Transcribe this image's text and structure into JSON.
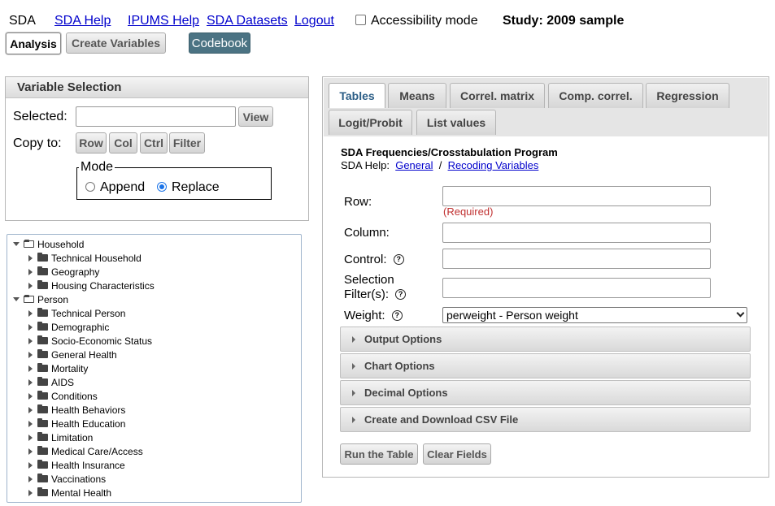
{
  "topnav": {
    "brand": "SDA",
    "links": [
      "SDA Help",
      "IPUMS Help",
      "SDA Datasets",
      "Logout"
    ],
    "accessibility_label": "Accessibility mode",
    "accessibility_checked": false,
    "study": "Study: 2009 sample"
  },
  "mode_buttons": {
    "analysis": "Analysis",
    "create_variables": "Create Variables",
    "codebook": "Codebook"
  },
  "variable_selection": {
    "title": "Variable Selection",
    "selected_label": "Selected:",
    "selected_value": "",
    "view_button": "View",
    "copy_to_label": "Copy to:",
    "copy_buttons": [
      "Row",
      "Col",
      "Ctrl",
      "Filter"
    ],
    "mode_legend": "Mode",
    "mode_options": [
      "Append",
      "Replace"
    ],
    "mode_selected": "Replace"
  },
  "tree": {
    "items": [
      {
        "label": "Household",
        "level": 0,
        "expanded": true
      },
      {
        "label": "Technical Household",
        "level": 1
      },
      {
        "label": "Geography",
        "level": 1
      },
      {
        "label": "Housing Characteristics",
        "level": 1
      },
      {
        "label": "Person",
        "level": 0,
        "expanded": true
      },
      {
        "label": "Technical Person",
        "level": 1
      },
      {
        "label": "Demographic",
        "level": 1
      },
      {
        "label": "Socio-Economic Status",
        "level": 1
      },
      {
        "label": "General Health",
        "level": 1
      },
      {
        "label": "Mortality",
        "level": 1
      },
      {
        "label": "AIDS",
        "level": 1
      },
      {
        "label": "Conditions",
        "level": 1
      },
      {
        "label": "Health Behaviors",
        "level": 1
      },
      {
        "label": "Health Education",
        "level": 1
      },
      {
        "label": "Limitation",
        "level": 1
      },
      {
        "label": "Medical Care/Access",
        "level": 1
      },
      {
        "label": "Health Insurance",
        "level": 1
      },
      {
        "label": "Vaccinations",
        "level": 1
      },
      {
        "label": "Mental Health",
        "level": 1
      }
    ]
  },
  "tabs": [
    "Tables",
    "Means",
    "Correl. matrix",
    "Comp. correl.",
    "Regression",
    "Logit/Probit",
    "List values"
  ],
  "active_tab": "Tables",
  "program": {
    "title": "SDA Frequencies/Crosstabulation Program",
    "help_label": "SDA Help:",
    "help_links": [
      "General",
      "Recoding Variables"
    ],
    "help_separator": "/"
  },
  "form": {
    "row_label": "Row:",
    "row_value": "",
    "required_text": "(Required)",
    "column_label": "Column:",
    "column_value": "",
    "control_label": "Control:",
    "control_value": "",
    "selection_label_1": "Selection",
    "selection_label_2": "Filter(s):",
    "selection_value": "",
    "weight_label": "Weight:",
    "weight_value": "perweight - Person weight",
    "help_glyph": "?"
  },
  "accordions": [
    "Output Options",
    "Chart Options",
    "Decimal Options",
    "Create and Download CSV File"
  ],
  "actions": {
    "run": "Run the Table",
    "clear": "Clear Fields"
  }
}
